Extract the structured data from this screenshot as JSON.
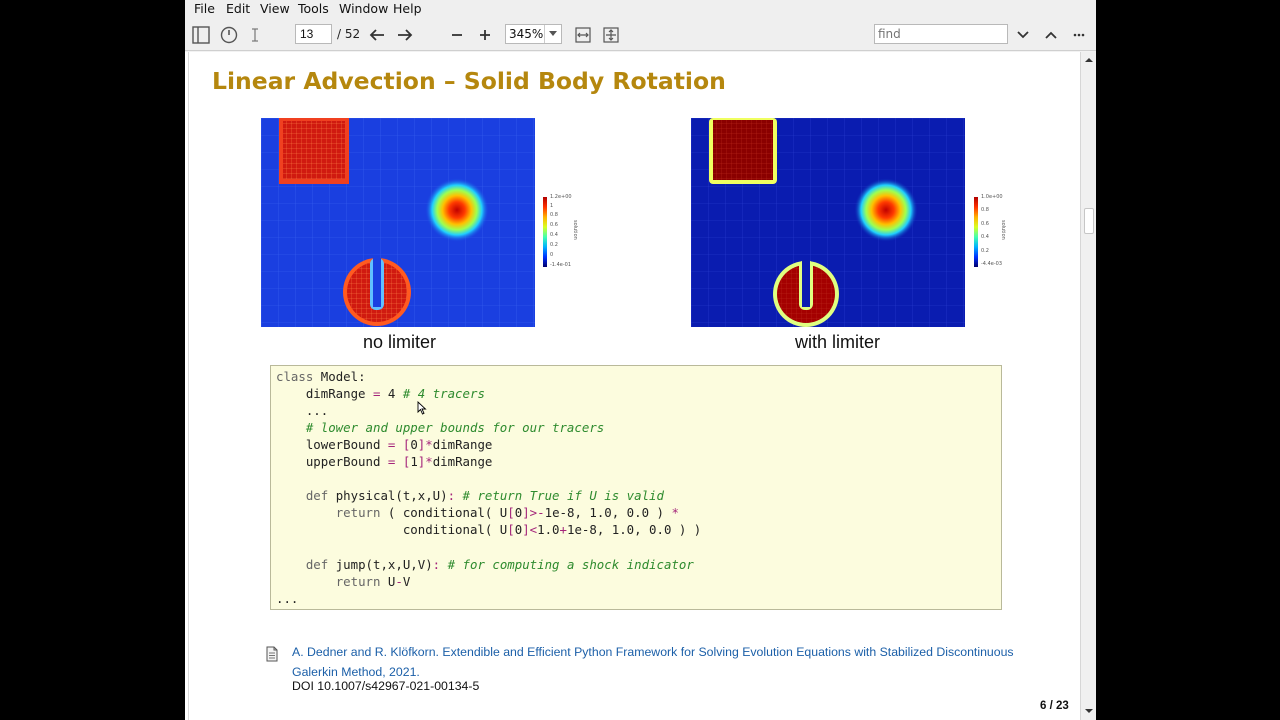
{
  "menu": [
    "File",
    "Edit",
    "View",
    "Tools",
    "Window",
    "Help"
  ],
  "toolbar": {
    "current_page": "13",
    "total_pages": "/ 52",
    "zoom": "345%",
    "find_placeholder": "find",
    "icons": [
      "sidebar-toggle-icon",
      "hand-tool-icon",
      "text-select-icon",
      "arrow-left-icon",
      "arrow-right-icon",
      "minus-icon",
      "plus-icon",
      "fit-width-icon",
      "fit-page-icon",
      "chevron-down-icon",
      "chevron-up-icon",
      "more-icon"
    ]
  },
  "slide": {
    "title": "Linear Advection – Solid Body Rotation",
    "panels": [
      {
        "caption": "no limiter",
        "colorbar": {
          "label": "solution",
          "ticks": [
            "1.2e+00",
            "1",
            "0.8",
            "0.6",
            "0.4",
            "0.2",
            "0",
            "-1.4e-01"
          ]
        }
      },
      {
        "caption": "with limiter",
        "colorbar": {
          "label": "solution",
          "ticks": [
            "1.0e+00",
            "0.8",
            "0.6",
            "0.4",
            "0.2",
            "-4.4e-03"
          ]
        }
      }
    ],
    "code_lines": [
      [
        {
          "t": "class",
          "c": "kw"
        },
        {
          "t": " Model:",
          "c": ""
        }
      ],
      [
        {
          "t": "    dimRange ",
          "c": ""
        },
        {
          "t": "=",
          "c": "op"
        },
        {
          "t": " 4 ",
          "c": ""
        },
        {
          "t": "# 4 tracers",
          "c": "cm"
        }
      ],
      [
        {
          "t": "    ...",
          "c": ""
        }
      ],
      [
        {
          "t": "    ",
          "c": ""
        },
        {
          "t": "# lower and upper bounds for our tracers",
          "c": "cm"
        }
      ],
      [
        {
          "t": "    lowerBound ",
          "c": ""
        },
        {
          "t": "=",
          "c": "op"
        },
        {
          "t": " ",
          "c": ""
        },
        {
          "t": "[",
          "c": "op"
        },
        {
          "t": "0",
          "c": ""
        },
        {
          "t": "]*",
          "c": "op"
        },
        {
          "t": "dimRange",
          "c": ""
        }
      ],
      [
        {
          "t": "    upperBound ",
          "c": ""
        },
        {
          "t": "=",
          "c": "op"
        },
        {
          "t": " ",
          "c": ""
        },
        {
          "t": "[",
          "c": "op"
        },
        {
          "t": "1",
          "c": ""
        },
        {
          "t": "]*",
          "c": "op"
        },
        {
          "t": "dimRange",
          "c": ""
        }
      ],
      [
        {
          "t": "",
          "c": ""
        }
      ],
      [
        {
          "t": "    ",
          "c": ""
        },
        {
          "t": "def",
          "c": "kw"
        },
        {
          "t": " physical(t,x,U)",
          "c": ""
        },
        {
          "t": ":",
          "c": "op"
        },
        {
          "t": " ",
          "c": ""
        },
        {
          "t": "# return True if U is valid",
          "c": "cm"
        }
      ],
      [
        {
          "t": "        ",
          "c": ""
        },
        {
          "t": "return",
          "c": "kw"
        },
        {
          "t": " ( conditional( U",
          "c": ""
        },
        {
          "t": "[",
          "c": "op"
        },
        {
          "t": "0",
          "c": ""
        },
        {
          "t": "]>-",
          "c": "op"
        },
        {
          "t": "1e-8, 1.0, 0.0 ) ",
          "c": ""
        },
        {
          "t": "*",
          "c": "op"
        }
      ],
      [
        {
          "t": "                 conditional( U",
          "c": ""
        },
        {
          "t": "[",
          "c": "op"
        },
        {
          "t": "0",
          "c": ""
        },
        {
          "t": "]<",
          "c": "op"
        },
        {
          "t": "1.0",
          "c": ""
        },
        {
          "t": "+",
          "c": "op"
        },
        {
          "t": "1e-8, 1.0, 0.0 ) )",
          "c": ""
        }
      ],
      [
        {
          "t": "",
          "c": ""
        }
      ],
      [
        {
          "t": "    ",
          "c": ""
        },
        {
          "t": "def",
          "c": "kw"
        },
        {
          "t": " jump(t,x,U,V)",
          "c": ""
        },
        {
          "t": ":",
          "c": "op"
        },
        {
          "t": " ",
          "c": ""
        },
        {
          "t": "# for computing a shock indicator",
          "c": "cm"
        }
      ],
      [
        {
          "t": "        ",
          "c": ""
        },
        {
          "t": "return",
          "c": "kw"
        },
        {
          "t": " U",
          "c": ""
        },
        {
          "t": "-",
          "c": "op"
        },
        {
          "t": "V",
          "c": ""
        }
      ],
      [
        {
          "t": "...",
          "c": ""
        }
      ]
    ],
    "reference": {
      "line1": "A. Dedner and R. Klöfkorn. Extendible and Efficient Python Framework for Solving Evolution Equations with Stabilized Discontinuous",
      "line2": "Galerkin Method, 2021.",
      "doi": "DOI 10.1007/s42967-021-00134-5"
    },
    "slide_number": "6 / 23"
  },
  "colors": {
    "title": "#b5870e",
    "code_bg": "#fcfcde",
    "comment": "#2e8b2e",
    "operator": "#a4247a",
    "link": "#1b5fa8",
    "field_bg": "#1a3fe0"
  }
}
